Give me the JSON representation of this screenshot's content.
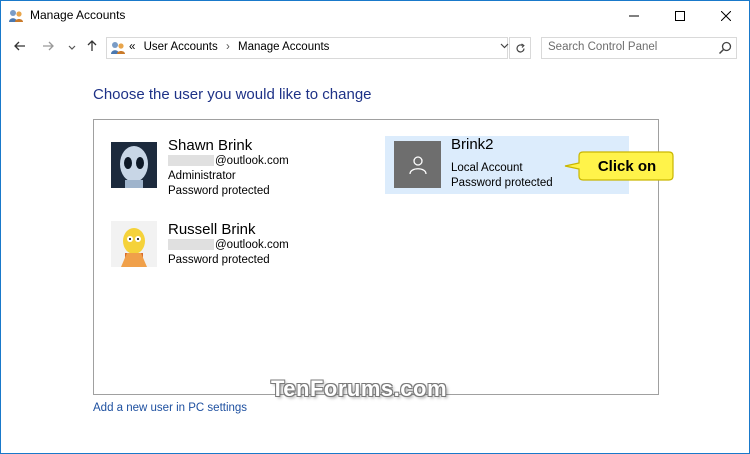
{
  "window": {
    "title": "Manage Accounts",
    "title_icon": "user-accounts-icon",
    "controls": {
      "minimize": "minimize-icon",
      "maximize": "maximize-icon",
      "close": "close-icon"
    }
  },
  "nav": {
    "back": "back-arrow-icon",
    "forward": "forward-arrow-icon",
    "recent": "chevron-down-icon",
    "up": "up-arrow-icon",
    "breadcrumb_overflow": "«",
    "breadcrumb": [
      "User Accounts",
      "Manage Accounts"
    ],
    "search_placeholder": "Search Control Panel"
  },
  "heading": "Choose the user you would like to change",
  "accounts": [
    {
      "name": "Shawn Brink",
      "email_suffix": "@outlook.com",
      "lines": [
        "Administrator",
        "Password protected"
      ],
      "avatar": "alien-avatar"
    },
    {
      "name": "Russell Brink",
      "email_suffix": "@outlook.com",
      "lines": [
        "Password protected"
      ],
      "avatar": "cartoon-avatar"
    },
    {
      "name": "Brink2",
      "lines": [
        "Local Account",
        "Password protected"
      ],
      "avatar": "default-user-avatar",
      "selected": true
    }
  ],
  "callout": {
    "text": "Click on",
    "color": "#fff34a"
  },
  "watermark": "TenForums.com",
  "add_user_link": "Add a new user in PC settings",
  "colors": {
    "heading": "#1e3287",
    "link": "#1e50a0",
    "selection": "#dcecfc",
    "window_border": "#1979ca"
  }
}
